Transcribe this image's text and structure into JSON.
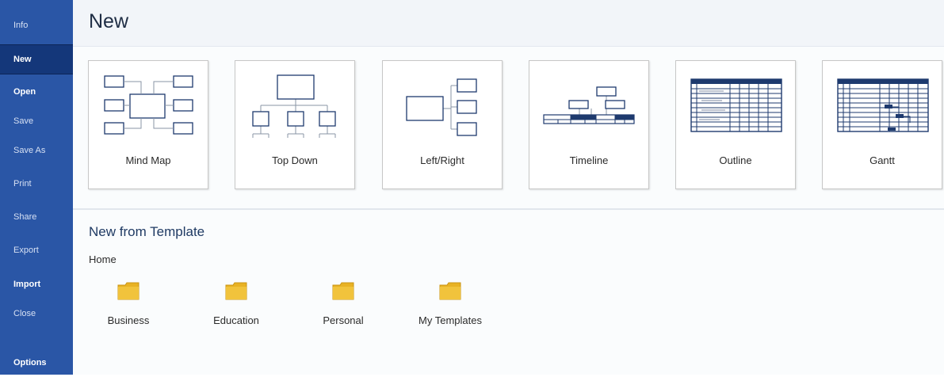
{
  "sidebar": {
    "items": [
      {
        "label": "Info"
      },
      {
        "label": "New"
      },
      {
        "label": "Open"
      },
      {
        "label": "Save"
      },
      {
        "label": "Save As"
      },
      {
        "label": "Print"
      },
      {
        "label": "Share"
      },
      {
        "label": "Export"
      },
      {
        "label": "Import"
      },
      {
        "label": "Close"
      },
      {
        "label": "Options"
      }
    ],
    "active_item": "New",
    "background_color": "#2a56a6",
    "active_color": "#14377a"
  },
  "main": {
    "title": "New",
    "tiles": [
      {
        "label": "Mind Map",
        "icon": "mind-map-icon"
      },
      {
        "label": "Top Down",
        "icon": "top-down-icon"
      },
      {
        "label": "Left/Right",
        "icon": "left-right-icon"
      },
      {
        "label": "Timeline",
        "icon": "timeline-icon"
      },
      {
        "label": "Outline",
        "icon": "outline-icon"
      },
      {
        "label": "Gantt",
        "icon": "gantt-icon"
      }
    ],
    "template_section": {
      "title": "New from Template",
      "group": "Home",
      "folders": [
        {
          "label": "Business",
          "icon": "folder-icon"
        },
        {
          "label": "Education",
          "icon": "folder-icon"
        },
        {
          "label": "Personal",
          "icon": "folder-icon"
        },
        {
          "label": "My Templates",
          "icon": "folder-icon"
        }
      ]
    },
    "folder_color": "#e8b224",
    "diagram_color": "#1e3a6e"
  }
}
